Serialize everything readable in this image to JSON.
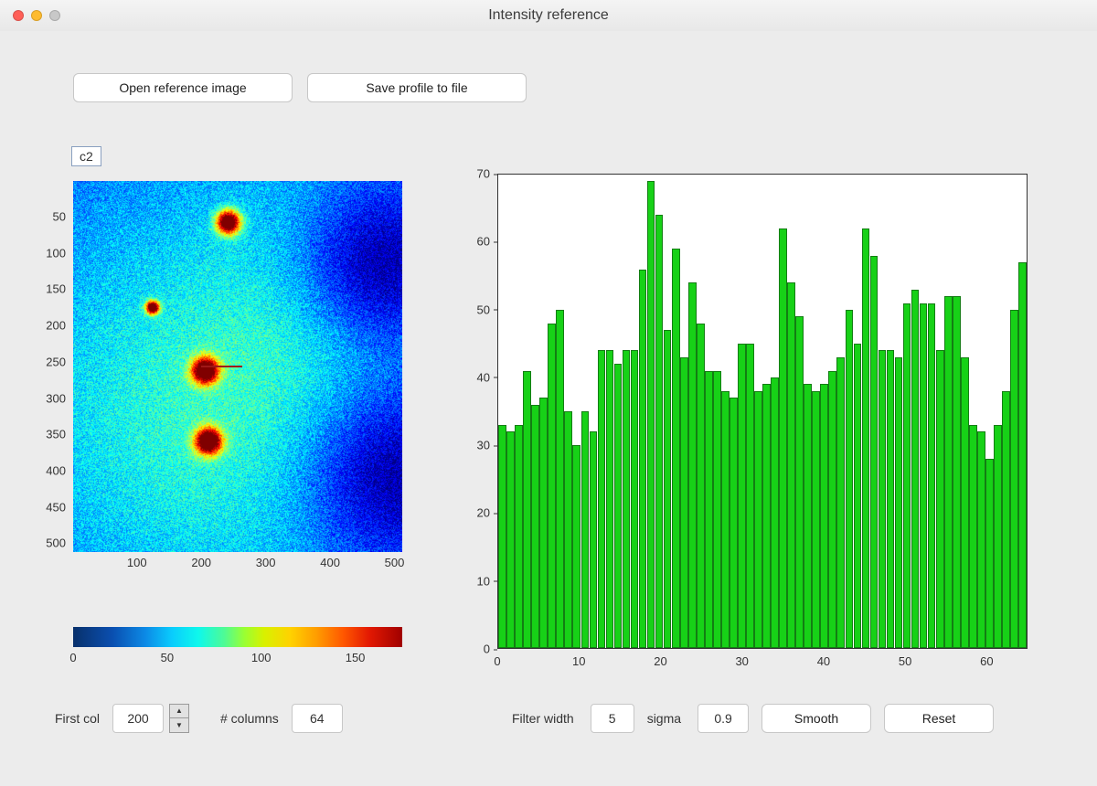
{
  "window": {
    "title": "Intensity reference"
  },
  "buttons": {
    "open_ref": "Open reference image",
    "save_profile": "Save profile to file",
    "smooth": "Smooth",
    "reset": "Reset",
    "spinner_up": "▲",
    "spinner_down": "▼"
  },
  "legend": "c2",
  "left_controls": {
    "first_col_label": "First col",
    "first_col_value": "200",
    "num_cols_label": "# columns",
    "num_cols_value": "64"
  },
  "right_controls": {
    "filter_label": "Filter width",
    "filter_value": "5",
    "sigma_label": "sigma",
    "sigma_value": "0.9"
  },
  "image_axes": {
    "y_ticks": [
      "50",
      "100",
      "150",
      "200",
      "250",
      "300",
      "350",
      "400",
      "450",
      "500"
    ],
    "y_range": [
      1,
      512
    ],
    "x_ticks": [
      "100",
      "200",
      "300",
      "400",
      "500"
    ],
    "x_range": [
      1,
      512
    ],
    "colorbar_ticks": [
      "0",
      "50",
      "100",
      "150"
    ],
    "colorbar_range": [
      0,
      175
    ],
    "roi": {
      "row": 255,
      "col_start": 200,
      "cols": 64
    }
  },
  "chart_data": {
    "type": "bar",
    "title": "",
    "xlabel": "",
    "ylabel": "",
    "xlim": [
      0,
      65
    ],
    "ylim": [
      0,
      70
    ],
    "x_ticks": [
      "0",
      "10",
      "20",
      "30",
      "40",
      "50",
      "60"
    ],
    "y_ticks": [
      "0",
      "10",
      "20",
      "30",
      "40",
      "50",
      "60",
      "70"
    ],
    "categories": [
      1,
      2,
      3,
      4,
      5,
      6,
      7,
      8,
      9,
      10,
      11,
      12,
      13,
      14,
      15,
      16,
      17,
      18,
      19,
      20,
      21,
      22,
      23,
      24,
      25,
      26,
      27,
      28,
      29,
      30,
      31,
      32,
      33,
      34,
      35,
      36,
      37,
      38,
      39,
      40,
      41,
      42,
      43,
      44,
      45,
      46,
      47,
      48,
      49,
      50,
      51,
      52,
      53,
      54,
      55,
      56,
      57,
      58,
      59,
      60,
      61,
      62,
      63,
      64
    ],
    "values": [
      33,
      32,
      33,
      41,
      36,
      37,
      48,
      50,
      35,
      30,
      35,
      32,
      44,
      44,
      42,
      44,
      44,
      56,
      69,
      64,
      47,
      59,
      43,
      54,
      48,
      41,
      41,
      38,
      37,
      45,
      45,
      38,
      39,
      40,
      62,
      54,
      49,
      39,
      38,
      39,
      41,
      43,
      50,
      45,
      62,
      58,
      44,
      44,
      43,
      51,
      53,
      51,
      51,
      44,
      52,
      52,
      43,
      33,
      32,
      28,
      33,
      38,
      50,
      57
    ]
  }
}
